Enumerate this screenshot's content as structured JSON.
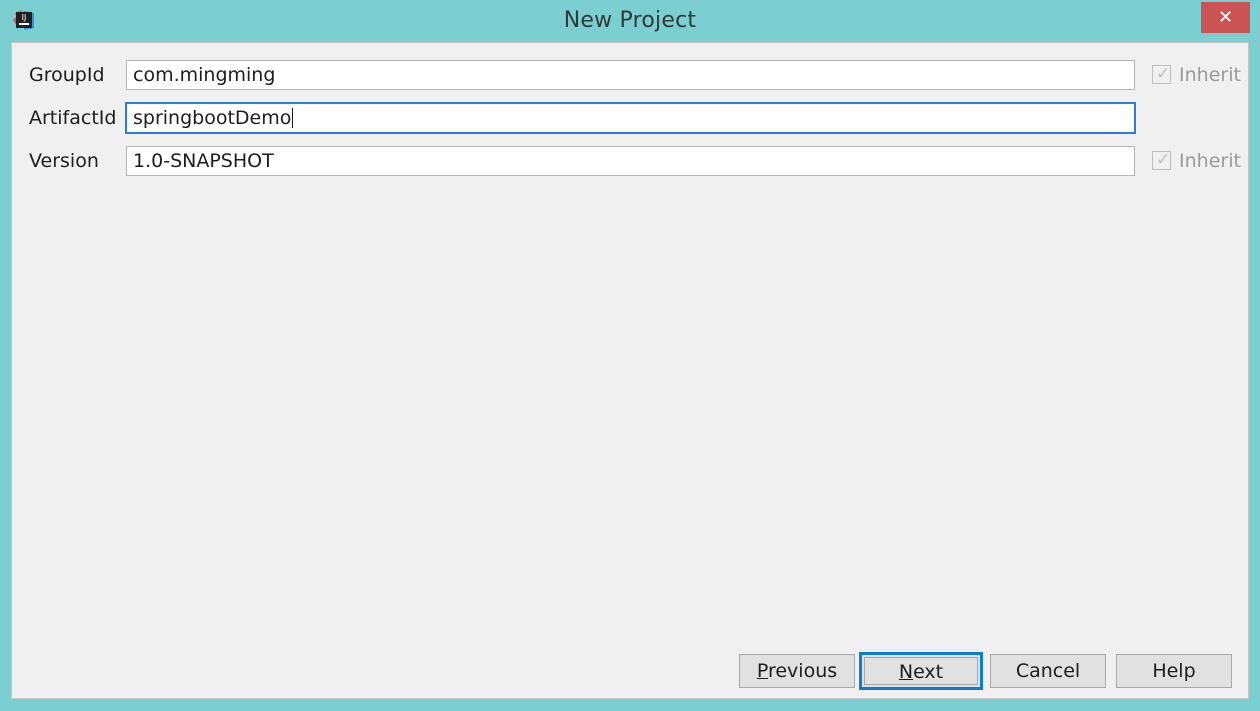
{
  "window": {
    "title": "New Project",
    "app_icon": "intellij-idea-icon",
    "close_label": "✕",
    "titlebar_color": "#7ccfd0",
    "panel_color": "#f0f0f0",
    "accent_focus_color": "#0c7cd5",
    "close_button_color": "#cb5354"
  },
  "form": {
    "rows": [
      {
        "label": "GroupId",
        "value": "com.mingming",
        "placeholder": "",
        "focused": false,
        "inherit": {
          "label": "Inherit",
          "checked": true,
          "enabled": false
        }
      },
      {
        "label": "ArtifactId",
        "value": "springbootDemo",
        "placeholder": "",
        "focused": true,
        "inherit": null
      },
      {
        "label": "Version",
        "value": "1.0-SNAPSHOT",
        "placeholder": "",
        "focused": false,
        "inherit": {
          "label": "Inherit",
          "checked": true,
          "enabled": false
        }
      }
    ]
  },
  "buttons": {
    "previous": {
      "label": "Previous",
      "mnemonic": "P",
      "rest": "revious",
      "focused": false
    },
    "next": {
      "label": "Next",
      "mnemonic": "N",
      "rest": "ext",
      "focused": true
    },
    "cancel": {
      "label": "Cancel",
      "focused": false
    },
    "help": {
      "label": "Help",
      "focused": false
    }
  }
}
